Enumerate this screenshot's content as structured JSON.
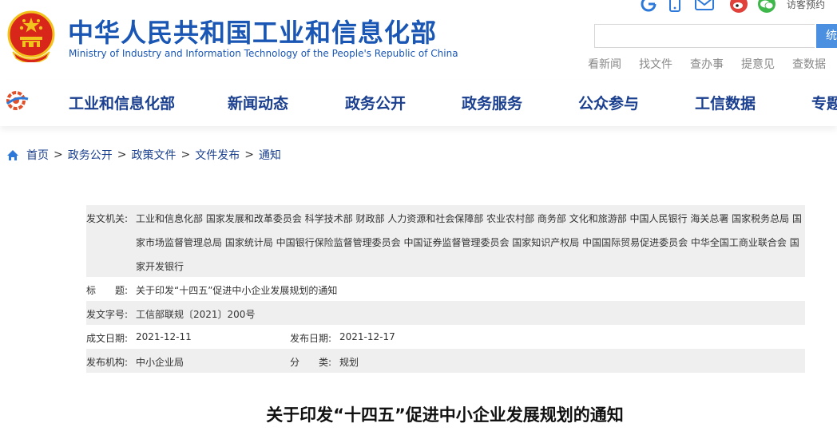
{
  "header": {
    "title": "中华人民共和国工业和信息化部",
    "subtitle": "Ministry of Industry and Information Technology of the People's Republic of China",
    "login_label": "访客预约",
    "search_button": "统",
    "quick_links": [
      "看新闻",
      "找文件",
      "查办事",
      "提意见",
      "查数据"
    ]
  },
  "nav": {
    "items": [
      "工业和信息化部",
      "新闻动态",
      "政务公开",
      "政务服务",
      "公众参与",
      "工信数据",
      "专题"
    ]
  },
  "breadcrumb": [
    "首页",
    "政务公开",
    "政策文件",
    "文件发布",
    "通知"
  ],
  "meta": {
    "issuer_label": "发文机关:",
    "issuer_line1": "工业和信息化部 国家发展和改革委员会 科学技术部 财政部 人力资源和社会保障部 农业农村部 商务部 文化和旅游部 中国人民银行 海关总署 国家税务总局 国",
    "issuer_line2": "家市场监督管理总局 国家统计局 中国银行保险监督管理委员会 中国证券监督管理委员会 国家知识产权局 中国国际贸易促进委员会 中华全国工商业联合会 国",
    "issuer_line3": "家开发银行",
    "title_label": "标　　题:",
    "title_value": "关于印发“十四五”促进中小企业发展规划的通知",
    "docno_label": "发文字号:",
    "docno_value": "工信部联规〔2021〕200号",
    "created_label": "成文日期:",
    "created_value": "2021-12-11",
    "published_label": "发布日期:",
    "published_value": "2021-12-17",
    "org_label": "发布机构:",
    "org_value": "中小企业局",
    "category_label": "分　　类:",
    "category_value": "规划"
  },
  "doc_title": "关于印发“十四五”促进中小企业发展规划的通知",
  "colors": {
    "brand_blue": "#1a56b4",
    "nav_blue": "#1a3f8f",
    "emblem_red": "#d8261a",
    "gold": "#f2c21d"
  }
}
